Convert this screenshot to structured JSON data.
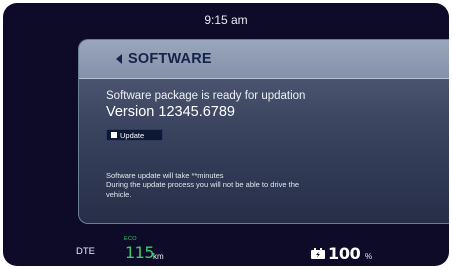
{
  "status_bar": {
    "time": "9:15 am"
  },
  "software_panel": {
    "title": "SOFTWARE",
    "back_icon": "chevron-left-icon",
    "ready_message": "Software package is ready for updation",
    "version": "Version 12345.6789",
    "update_button_label": "Update",
    "update_button_icon": "checkbox-icon",
    "note_line_1": "Software update will take **minutes",
    "note_line_2": "During the update process you will not be able to drive the",
    "note_line_3": "vehicle."
  },
  "bottom_bar": {
    "dte_label": "DTE",
    "eco_label": "ECO",
    "range_value": "115",
    "range_unit": "km",
    "battery_icon": "battery-icon",
    "battery_value": "100",
    "battery_unit": "%"
  },
  "colors": {
    "background": "#0d0b28",
    "panel_header": "#8391a9",
    "accent_green": "#3ccd6a",
    "title_text": "#16224a"
  }
}
